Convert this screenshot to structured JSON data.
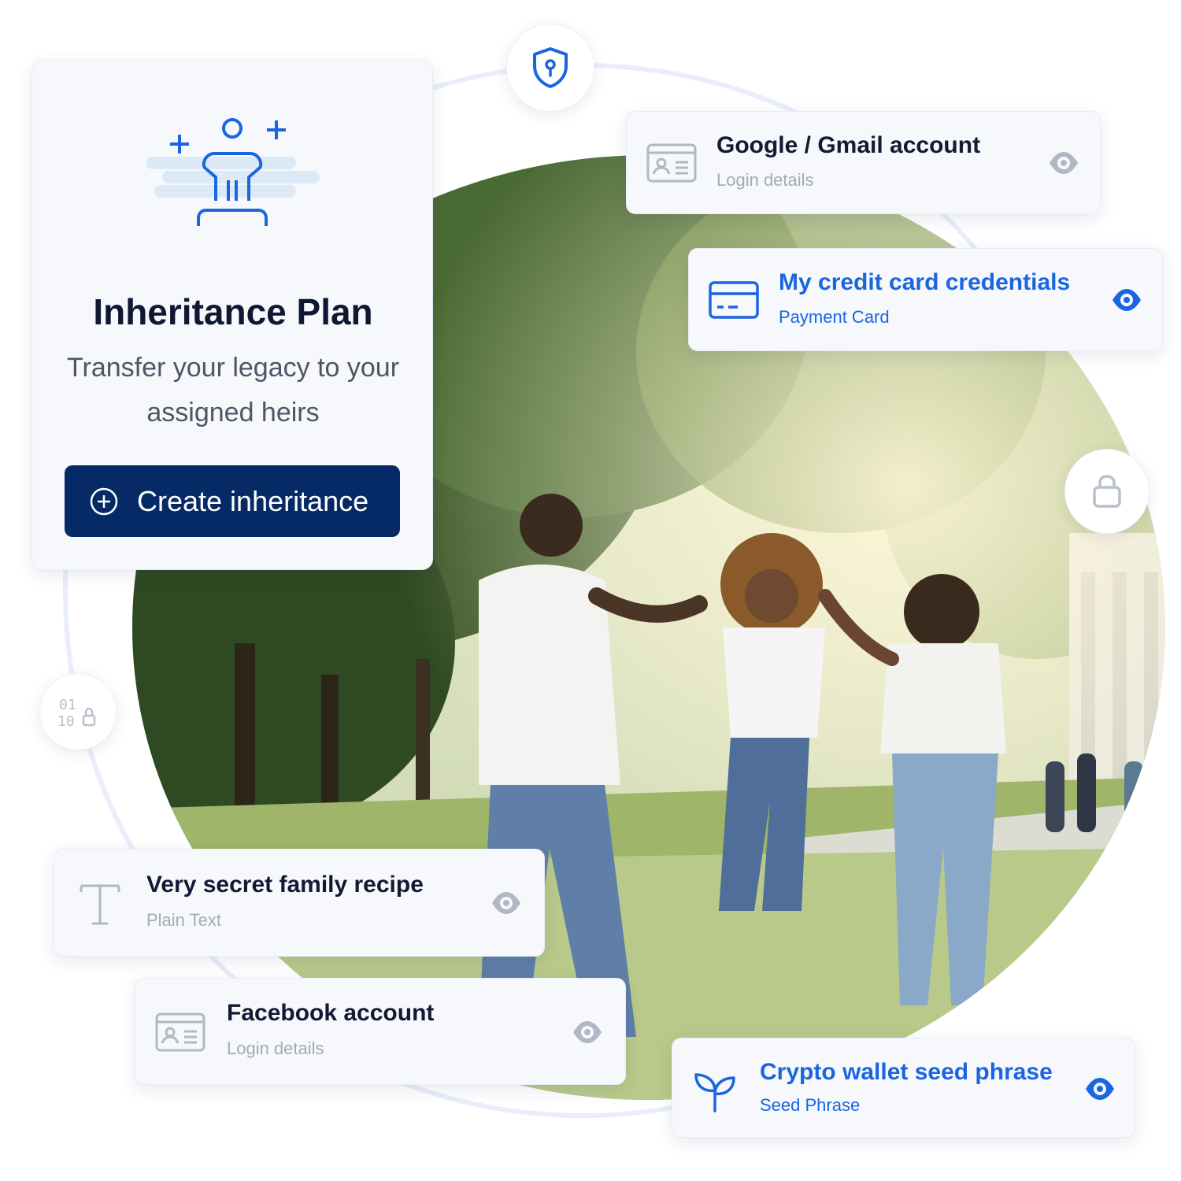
{
  "plan": {
    "title": "Inheritance Plan",
    "description": "Transfer your legacy to your assigned heirs",
    "cta_label": "Create inheritance",
    "icon": "person-plus-icon",
    "cta_icon": "plus-circle-icon"
  },
  "items": [
    {
      "title": "Google / Gmail account",
      "subtitle": "Login details",
      "icon": "id-card-icon",
      "highlighted": false
    },
    {
      "title": "My credit card credentials",
      "subtitle": "Payment Card",
      "icon": "credit-card-icon",
      "highlighted": true
    },
    {
      "title": "Very secret family recipe",
      "subtitle": "Plain Text",
      "icon": "text-icon",
      "highlighted": false
    },
    {
      "title": "Facebook account",
      "subtitle": "Login details",
      "icon": "id-card-icon",
      "highlighted": false
    },
    {
      "title": "Crypto wallet seed phrase",
      "subtitle": "Seed Phrase",
      "icon": "sprout-icon",
      "highlighted": true
    }
  ],
  "nodes": [
    "shield-icon",
    "lock-icon",
    "binary-lock-icon"
  ],
  "photo": {
    "icon": "family-photo",
    "description": ""
  },
  "colors": {
    "accent": "#1a66e0",
    "primary_button": "#062a66",
    "muted": "#a3aab8",
    "title": "#121a33"
  }
}
